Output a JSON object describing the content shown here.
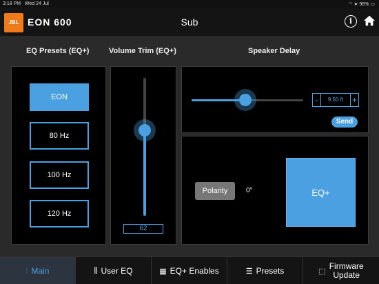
{
  "status_bar": {
    "time": "3:18 PM",
    "date": "Wed 24 Jul",
    "battery": "98%"
  },
  "header": {
    "logo_badge": "JBL",
    "logo_text": "EON 600",
    "title": "Sub"
  },
  "sections": {
    "eq_presets_label": "EQ Presets (EQ+)",
    "volume_trim_label": "Volume Trim (EQ+)",
    "speaker_delay_label": "Speaker Delay"
  },
  "eq_presets": [
    {
      "label": "EON",
      "active": true
    },
    {
      "label": "80 Hz",
      "active": false
    },
    {
      "label": "100 Hz",
      "active": false
    },
    {
      "label": "120 Hz",
      "active": false
    }
  ],
  "volume_trim": {
    "value": "62",
    "level": 0.62
  },
  "speaker_delay": {
    "value": "9.50 ft",
    "minus": "-",
    "plus": "+",
    "send_label": "Send",
    "slider_level": 0.48
  },
  "polarity": {
    "button_label": "Polarity",
    "value": "0°"
  },
  "eq_plus_label": "EQ+",
  "tabs": [
    {
      "label": "Main",
      "icon": "sliders-icon",
      "active": true
    },
    {
      "label": "User EQ",
      "icon": "waveform-icon",
      "active": false
    },
    {
      "label": "EQ+ Enables",
      "icon": "calculator-icon",
      "active": false
    },
    {
      "label": "Presets",
      "icon": "list-icon",
      "active": false
    },
    {
      "label": "Firmware Update",
      "icon": "firmware-icon",
      "active": false
    }
  ],
  "colors": {
    "accent": "#4aa0e0",
    "brand": "#f07a1a",
    "background": "#000000",
    "panel": "#2a2a2a"
  }
}
